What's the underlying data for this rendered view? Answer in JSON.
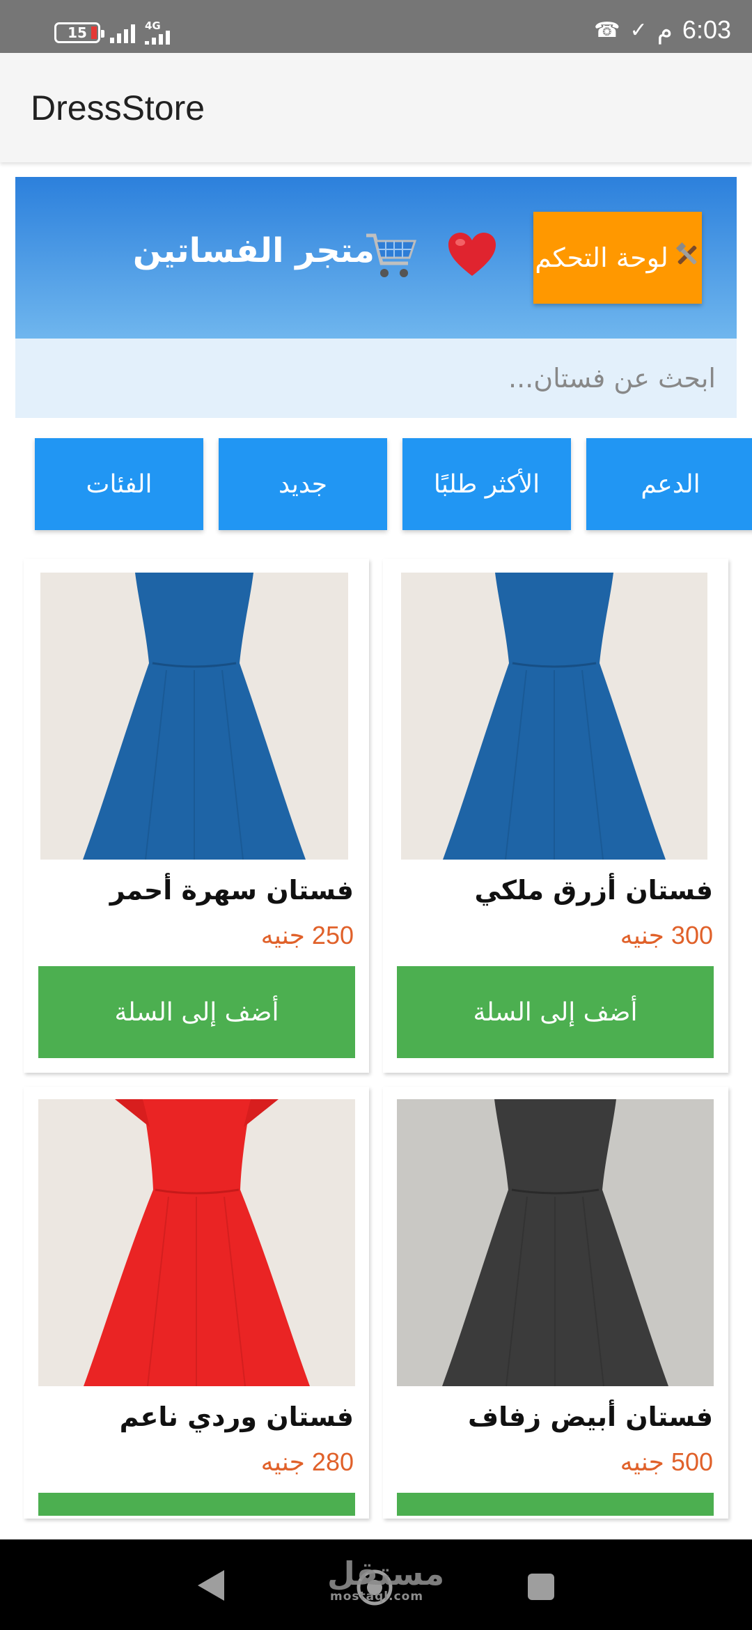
{
  "status_bar": {
    "battery": "15",
    "network": "4G",
    "ampm": "م",
    "time": "6:03"
  },
  "app_bar": {
    "title": "DressStore"
  },
  "banner": {
    "dashboard_label": "لوحة التحكم",
    "store_title": "متجر الفساتين",
    "dashboard_color": "#ff9800",
    "banner_color": "#2c80dc"
  },
  "search": {
    "placeholder": "ابحث عن فستان..."
  },
  "categories": [
    "الدعم",
    "الأكثر طلبًا",
    "جديد",
    "الفئات"
  ],
  "products": [
    {
      "name": "فستان أزرق ملكي",
      "price": "300 جنيه",
      "button": "أضف إلى السلة",
      "color": "#1e64a6"
    },
    {
      "name": "فستان سهرة أحمر",
      "price": "250 جنيه",
      "button": "أضف إلى السلة",
      "color": "#1e64a6"
    },
    {
      "name": "فستان أبيض زفاف",
      "price": "500 جنيه",
      "button": "",
      "color": "#3b3b3b"
    },
    {
      "name": "فستان وردي ناعم",
      "price": "280 جنيه",
      "button": "",
      "color": "#ea2424"
    }
  ],
  "watermark": {
    "arabic": "مستقل",
    "latin": "mostaql.com"
  }
}
